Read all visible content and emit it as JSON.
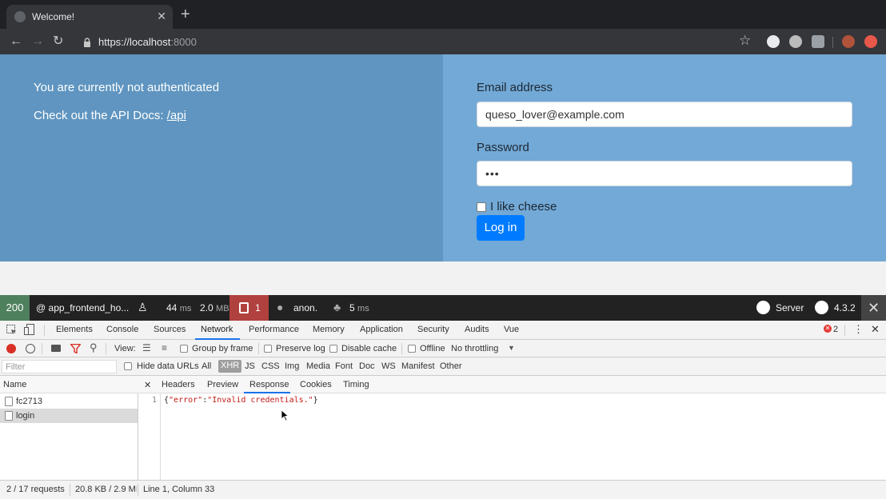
{
  "browser": {
    "tab_title": "Welcome!",
    "new_tab": "+",
    "url_host": "https://localhost",
    "url_port": ":8000"
  },
  "page": {
    "not_auth": "You are currently not authenticated",
    "api_prefix": "Check out the API Docs: ",
    "api_link": "/api",
    "email_label": "Email address",
    "email_value": "queso_lover@example.com",
    "password_label": "Password",
    "password_value": "•••",
    "checkbox_label": "I like cheese",
    "login_button": "Log in"
  },
  "symfony_bar": {
    "status": "200",
    "route": "@ app_frontend_ho...",
    "time": "44",
    "time_unit": "ms",
    "memory": "2.0",
    "memory_unit": "MB",
    "ajax_count": "1",
    "user": "anon.",
    "twig_time": "5",
    "twig_unit": "ms",
    "server": "Server",
    "version": "4.3.2"
  },
  "devtools": {
    "tabs": [
      "Elements",
      "Console",
      "Sources",
      "Network",
      "Performance",
      "Memory",
      "Application",
      "Security",
      "Audits",
      "Vue"
    ],
    "error_count": "2",
    "view_label": "View:",
    "group_by_frame": "Group by frame",
    "preserve_log": "Preserve log",
    "disable_cache": "Disable cache",
    "offline": "Offline",
    "throttling": "No throttling",
    "filter_placeholder": "Filter",
    "hide_data_urls": "Hide data URLs",
    "filter_types": [
      "All",
      "XHR",
      "JS",
      "CSS",
      "Img",
      "Media",
      "Font",
      "Doc",
      "WS",
      "Manifest",
      "Other"
    ],
    "name_header": "Name",
    "requests": [
      "fc2713",
      "login"
    ],
    "sub_tabs": [
      "Headers",
      "Preview",
      "Response",
      "Cookies",
      "Timing"
    ],
    "line_number": "1",
    "response_open": "{",
    "response_key": "\"error\"",
    "response_colon": ":",
    "response_value": "\"Invalid credentials.\"",
    "response_close": "}",
    "status_requests": "2 / 17 requests",
    "status_size": "20.8 KB / 2.9 MB",
    "status_cursor": "Line 1, Column 33"
  }
}
